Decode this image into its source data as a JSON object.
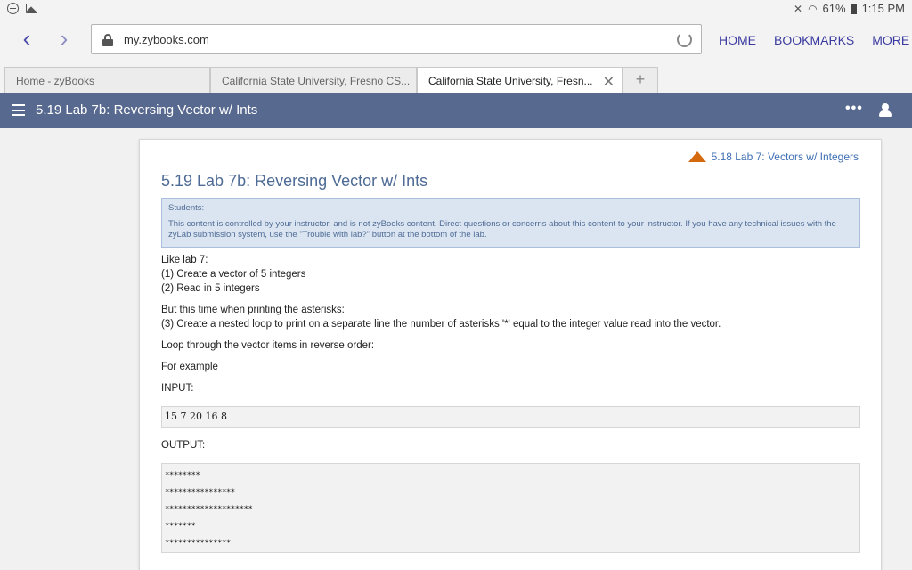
{
  "status_bar": {
    "battery": "61%",
    "time": "1:15 PM"
  },
  "browser": {
    "url": "my.zybooks.com",
    "menu": [
      "HOME",
      "BOOKMARKS",
      "MORE"
    ],
    "tabs": [
      {
        "label": "Home - zyBooks"
      },
      {
        "label": "California State University, Fresno CS..."
      },
      {
        "label": "California State University, Fresn..."
      }
    ],
    "new_tab": "+",
    "close_tab": "✕"
  },
  "header": {
    "title": "5.19 Lab 7b: Reversing Vector w/ Ints",
    "more": "•••"
  },
  "content": {
    "prev_link": "5.18 Lab 7: Vectors w/ Integers",
    "title": "5.19 Lab 7b: Reversing Vector w/ Ints",
    "notice_heading": "Students:",
    "notice_body": "This content is controlled by your instructor, and is not zyBooks content. Direct questions or concerns about this content to your instructor. If you have any technical issues with the zyLab submission system, use the \"Trouble with lab?\" button at the bottom of the lab.",
    "p1_lines": [
      "Like lab 7:",
      "(1) Create a vector of 5 integers",
      "(2) Read in 5 integers"
    ],
    "p2_lines": [
      "But this time when printing the asterisks:",
      "(3) Create a nested loop to print on a separate line the number of asterisks '*' equal to the integer value read into the vector."
    ],
    "p3": "Loop through the vector items in reverse order:",
    "p4": "For example",
    "input_label": "INPUT:",
    "input_value": "15 7 20 16 8",
    "output_label": "OUTPUT:",
    "output_lines": [
      "********",
      "****************",
      "********************",
      "*******",
      "***************"
    ]
  }
}
